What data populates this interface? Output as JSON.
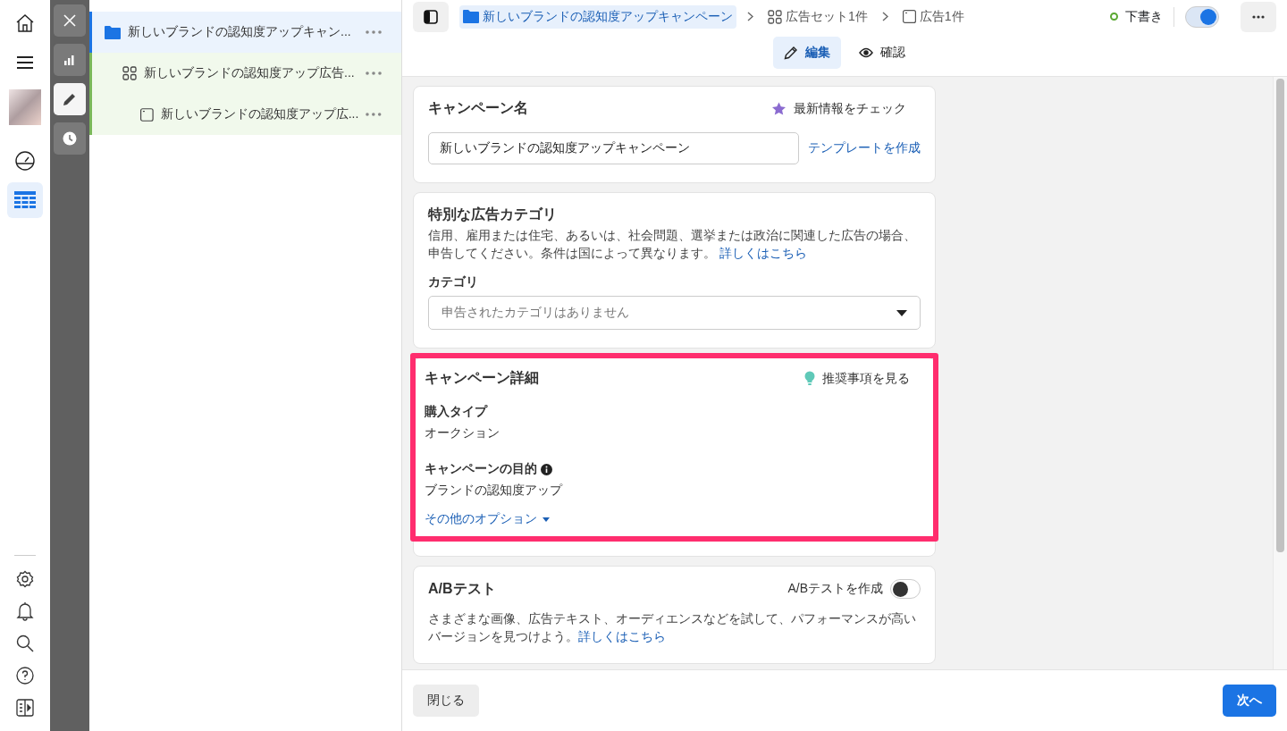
{
  "nav_rail": {
    "items": [
      {
        "kind": "home",
        "selected": false
      },
      {
        "kind": "menu",
        "selected": false
      },
      {
        "kind": "avatar",
        "selected": false
      },
      {
        "kind": "gauge",
        "selected": false
      },
      {
        "kind": "table",
        "selected": true
      }
    ],
    "bottom_items": [
      {
        "kind": "settings"
      },
      {
        "kind": "bell"
      },
      {
        "kind": "search"
      },
      {
        "kind": "help"
      },
      {
        "kind": "panel"
      }
    ]
  },
  "tool_rail": {
    "items": [
      {
        "kind": "close",
        "selected": false
      },
      {
        "kind": "chart",
        "selected": false
      },
      {
        "kind": "edit",
        "selected": true
      },
      {
        "kind": "history",
        "selected": false
      }
    ]
  },
  "tree": {
    "items": [
      {
        "kind": "campaign",
        "label": "新しいブランドの認知度アップキャン...",
        "children": [
          {
            "kind": "adset",
            "label": "新しいブランドの認知度アップ広告...",
            "children": [
              {
                "kind": "ad",
                "label": "新しいブランドの認知度アップ広..."
              }
            ]
          }
        ]
      }
    ]
  },
  "header": {
    "breadcrumbs": [
      {
        "kind": "campaign",
        "label": "新しいブランドの認知度アップキャンペーン",
        "selected": true
      },
      {
        "kind": "adset",
        "label": "広告セット1件",
        "selected": false
      },
      {
        "kind": "ad",
        "label": "広告1件",
        "selected": false
      }
    ],
    "status": "下書き",
    "toggle_on": true,
    "tabs": [
      {
        "kind": "edit",
        "label": "編集",
        "selected": true
      },
      {
        "kind": "review",
        "label": "確認",
        "selected": false
      }
    ]
  },
  "cards": [
    {
      "kind": "name",
      "title": "キャンペーン名",
      "aside": "最新情報をチェック",
      "value": "新しいブランドの認知度アップキャンペーン",
      "link": "テンプレートを作成",
      "highlighted": false
    },
    {
      "kind": "category",
      "title": "特別な広告カテゴリ",
      "description": "信用、雇用または住宅、あるいは、社会問題、選挙または政治に関連した広告の場合、申告してください。条件は国によって異なります。",
      "link": "詳しくはこちら",
      "field_label": "カテゴリ",
      "placeholder": "申告されたカテゴリはありません",
      "highlighted": false
    },
    {
      "kind": "details",
      "title": "キャンペーン詳細",
      "aside": "推奨事項を見る",
      "fields": [
        {
          "label": "購入タイプ",
          "value": "オークション",
          "info": false
        },
        {
          "label": "キャンペーンの目的",
          "value": "ブランドの認知度アップ",
          "info": true
        }
      ],
      "more": "その他のオプション",
      "highlighted": true
    },
    {
      "kind": "ab_test",
      "title": "A/Bテスト",
      "toggle_label": "A/Bテストを作成",
      "toggle_on": false,
      "description": "さまざまな画像、広告テキスト、オーディエンスなどを試して、パフォーマンスが高いバージョンを見つけよう。",
      "link": "詳しくはこちら",
      "highlighted": false
    }
  ],
  "footer": {
    "close": "閉じる",
    "next": "次へ"
  }
}
